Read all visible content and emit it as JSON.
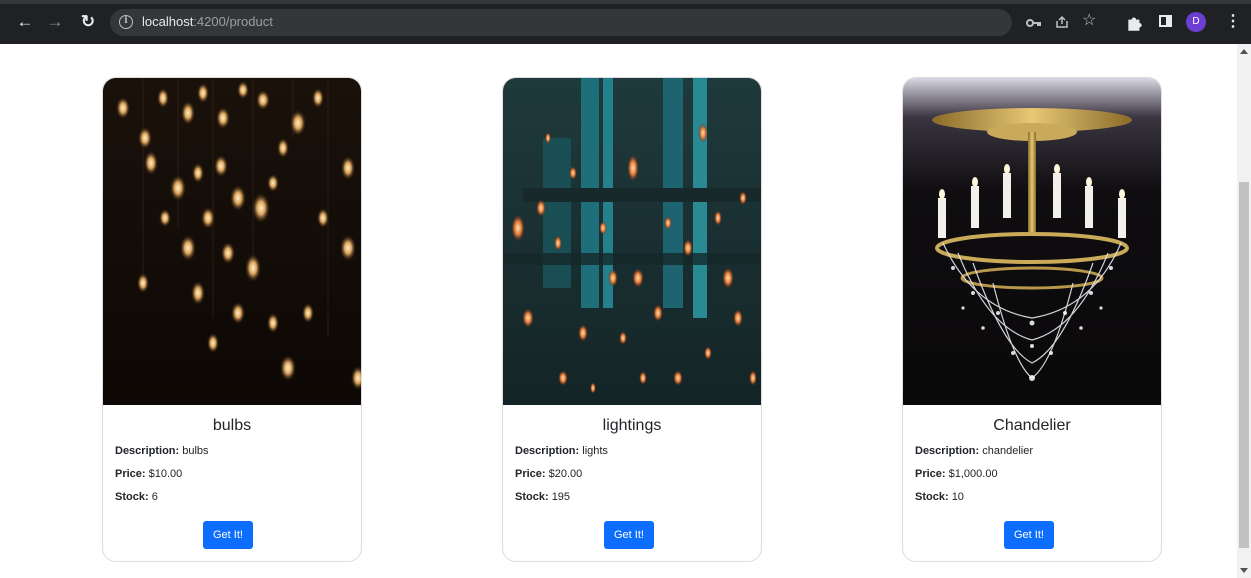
{
  "browser": {
    "url_host": "localhost",
    "url_path": ":4200/product",
    "profile_initial": "D"
  },
  "products": [
    {
      "name": "bulbs",
      "description_label": "Description:",
      "description": "bulbs",
      "price_label": "Price:",
      "price": "$10.00",
      "stock_label": "Stock:",
      "stock": "6",
      "button_label": "Get It!"
    },
    {
      "name": "lightings",
      "description_label": "Description:",
      "description": "lights",
      "price_label": "Price:",
      "price": "$20.00",
      "stock_label": "Stock:",
      "stock": "195",
      "button_label": "Get It!"
    },
    {
      "name": "Chandelier",
      "description_label": "Description:",
      "description": "chandelier",
      "price_label": "Price:",
      "price": "$1,000.00",
      "stock_label": "Stock:",
      "stock": "10",
      "button_label": "Get It!"
    }
  ],
  "colors": {
    "chrome_bg": "#202124",
    "button_primary": "#0d6efd",
    "card_border": "#dcdcdc"
  },
  "icons": [
    "back-arrow-icon",
    "forward-arrow-icon",
    "reload-icon",
    "info-icon",
    "key-icon",
    "share-icon",
    "star-icon",
    "extensions-icon",
    "side-panel-icon",
    "profile-avatar",
    "menu-kebab-icon"
  ]
}
